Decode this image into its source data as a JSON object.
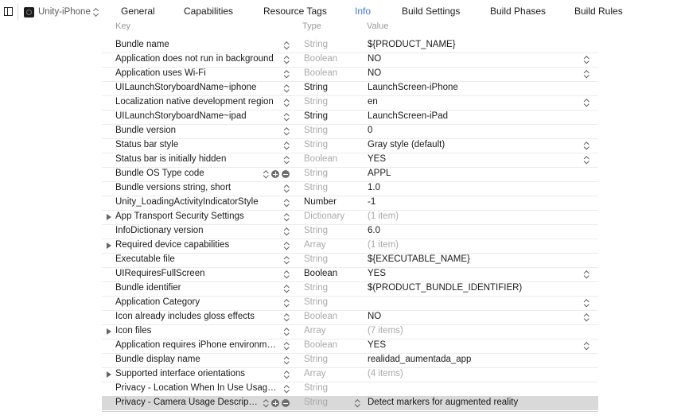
{
  "target": {
    "name": "Unity-iPhone"
  },
  "tabs": [
    "General",
    "Capabilities",
    "Resource Tags",
    "Info",
    "Build Settings",
    "Build Phases",
    "Build Rules"
  ],
  "active_tab": "Info",
  "columns": {
    "key": "Key",
    "type": "Type",
    "value": "Value"
  },
  "rows": [
    {
      "key": "Bundle name",
      "type": "String",
      "value": "${PRODUCT_NAME}"
    },
    {
      "key": "Application does not run in background",
      "type": "Boolean",
      "value": "NO"
    },
    {
      "key": "Application uses Wi-Fi",
      "type": "Boolean",
      "value": "NO"
    },
    {
      "key": "UILaunchStoryboardName~iphone",
      "type": "String",
      "value": "LaunchScreen-iPhone"
    },
    {
      "key": "Localization native development region",
      "type": "String",
      "value": "en"
    },
    {
      "key": "UILaunchStoryboardName~ipad",
      "type": "String",
      "value": "LaunchScreen-iPad"
    },
    {
      "key": "Bundle version",
      "type": "String",
      "value": "0"
    },
    {
      "key": "Status bar style",
      "type": "String",
      "value": "Gray style (default)"
    },
    {
      "key": "Status bar is initially hidden",
      "type": "Boolean",
      "value": "YES"
    },
    {
      "key": "Bundle OS Type code",
      "type": "String",
      "value": "APPL"
    },
    {
      "key": "Bundle versions string, short",
      "type": "String",
      "value": "1.0"
    },
    {
      "key": "Unity_LoadingActivityIndicatorStyle",
      "type": "Number",
      "value": "-1"
    },
    {
      "key": "App Transport Security Settings",
      "type": "Dictionary",
      "value": "(1 item)"
    },
    {
      "key": "InfoDictionary version",
      "type": "String",
      "value": "6.0"
    },
    {
      "key": "Required device capabilities",
      "type": "Array",
      "value": "(1 item)"
    },
    {
      "key": "Executable file",
      "type": "String",
      "value": "${EXECUTABLE_NAME}"
    },
    {
      "key": "UIRequiresFullScreen",
      "type": "Boolean",
      "value": "YES"
    },
    {
      "key": "Bundle identifier",
      "type": "String",
      "value": "$(PRODUCT_BUNDLE_IDENTIFIER)"
    },
    {
      "key": "Application Category",
      "type": "String",
      "value": ""
    },
    {
      "key": "Icon already includes gloss effects",
      "type": "Boolean",
      "value": "NO"
    },
    {
      "key": "Icon files",
      "type": "Array",
      "value": "(7 items)"
    },
    {
      "key": "Application requires iPhone environm…",
      "type": "Boolean",
      "value": "YES"
    },
    {
      "key": "Bundle display name",
      "type": "String",
      "value": "realidad_aumentada_app"
    },
    {
      "key": "Supported interface orientations",
      "type": "Array",
      "value": "(4 items)"
    },
    {
      "key": "Privacy - Location When In Use Usag…",
      "type": "String",
      "value": ""
    },
    {
      "key": "Privacy - Camera Usage Descrip…",
      "type": "String",
      "value": "Detect markers for augmented reality"
    }
  ]
}
